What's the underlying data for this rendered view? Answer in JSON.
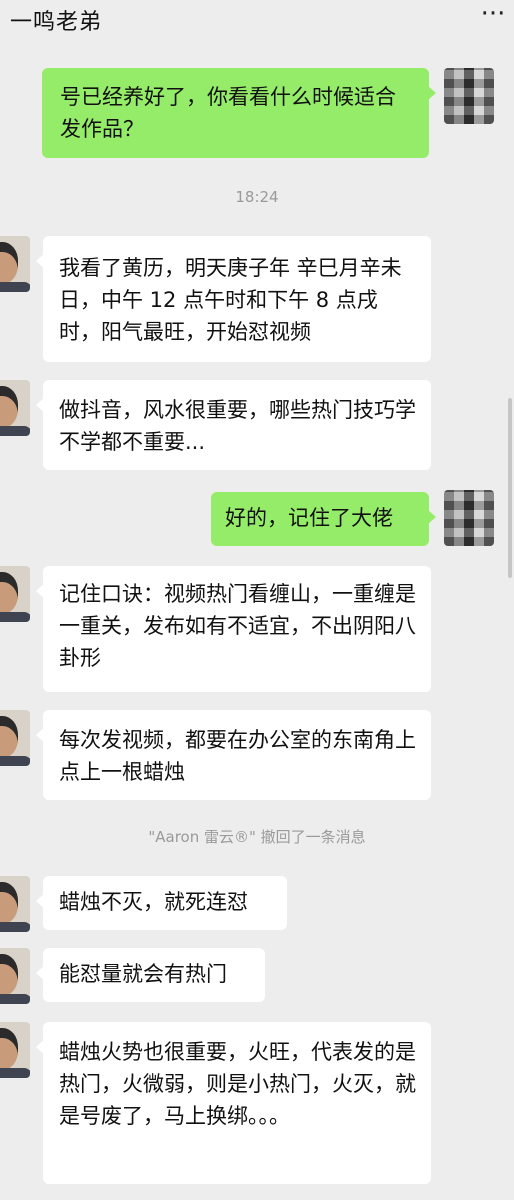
{
  "header": {
    "title": "一鸣老弟",
    "more_icon": "more-dots-icon"
  },
  "timestamp": "18:24",
  "system_message": "\"Aaron 雷云®\" 撤回了一条消息",
  "colors": {
    "background": "#ededed",
    "outgoing_bubble": "#95ec69",
    "incoming_bubble": "#ffffff"
  },
  "messages": [
    {
      "side": "out",
      "text": "号已经养好了，你看看什么时候适合发作品？"
    },
    {
      "side": "in",
      "text": "我看了黄历，明天庚子年 辛巳月辛未日，中午 12 点午时和下午 8 点戌时，阳气最旺，开始怼视频"
    },
    {
      "side": "in",
      "text": "做抖音，风水很重要，哪些热门技巧学不学都不重要..."
    },
    {
      "side": "out",
      "text": "好的，记住了大佬"
    },
    {
      "side": "in",
      "text": "记住口诀：视频热门看缠山，一重缠是一重关，发布如有不适宜，不出阴阳八卦形"
    },
    {
      "side": "in",
      "text": "每次发视频，都要在办公室的东南角上点上一根蜡烛"
    },
    {
      "side": "in",
      "text": "蜡烛不灭，就死连怼"
    },
    {
      "side": "in",
      "text": "能怼量就会有热门"
    },
    {
      "side": "in",
      "text": "蜡烛火势也很重要，火旺，代表发的是热门，火微弱，则是小热门，火灭，就是号废了，马上换绑。。。"
    }
  ]
}
